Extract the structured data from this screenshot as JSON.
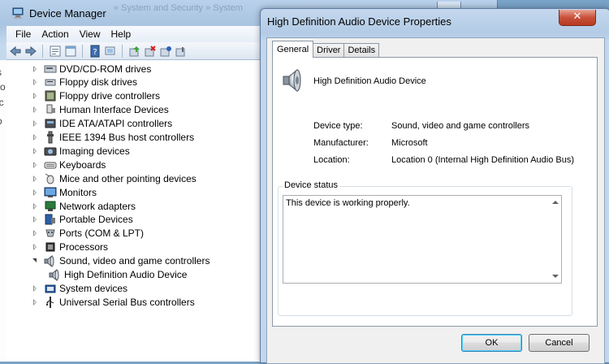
{
  "device_manager": {
    "title": "Device Manager",
    "title_ghost": "« System and Security » System",
    "menu": [
      "File",
      "Action",
      "View",
      "Help"
    ],
    "toolbar_icons": [
      "back-icon",
      "forward-icon",
      "properties-icon",
      "show-hide-icon",
      "help-icon",
      "update-driver-icon",
      "scan-icon",
      "uninstall-icon",
      "disable-icon",
      "enable-icon"
    ],
    "tree": [
      {
        "label": "DVD/CD-ROM drives",
        "icon": "dvd-drive-icon",
        "state": "closed"
      },
      {
        "label": "Floppy disk drives",
        "icon": "floppy-disk-icon",
        "state": "closed"
      },
      {
        "label": "Floppy drive controllers",
        "icon": "floppy-controller-icon",
        "state": "closed"
      },
      {
        "label": "Human Interface Devices",
        "icon": "hid-icon",
        "state": "closed"
      },
      {
        "label": "IDE ATA/ATAPI controllers",
        "icon": "ide-controller-icon",
        "state": "closed"
      },
      {
        "label": "IEEE 1394 Bus host controllers",
        "icon": "firewire-icon",
        "state": "closed"
      },
      {
        "label": "Imaging devices",
        "icon": "camera-icon",
        "state": "closed"
      },
      {
        "label": "Keyboards",
        "icon": "keyboard-icon",
        "state": "closed"
      },
      {
        "label": "Mice and other pointing devices",
        "icon": "mouse-icon",
        "state": "closed"
      },
      {
        "label": "Monitors",
        "icon": "monitor-icon",
        "state": "closed"
      },
      {
        "label": "Network adapters",
        "icon": "network-adapter-icon",
        "state": "closed"
      },
      {
        "label": "Portable Devices",
        "icon": "portable-device-icon",
        "state": "closed"
      },
      {
        "label": "Ports (COM & LPT)",
        "icon": "port-icon",
        "state": "closed"
      },
      {
        "label": "Processors",
        "icon": "processor-icon",
        "state": "closed"
      },
      {
        "label": "Sound, video and game controllers",
        "icon": "speaker-icon",
        "state": "open"
      },
      {
        "label": "High Definition Audio Device",
        "icon": "speaker-icon",
        "state": "child"
      },
      {
        "label": "System devices",
        "icon": "system-device-icon",
        "state": "closed"
      },
      {
        "label": "Universal Serial Bus controllers",
        "icon": "usb-icon",
        "state": "closed"
      }
    ],
    "sliver_text": [
      "s",
      "ro",
      "ic",
      "o"
    ]
  },
  "dialog": {
    "title": "High Definition Audio Device Properties",
    "close_glyph": "✕",
    "tabs": [
      "General",
      "Driver",
      "Details"
    ],
    "device_name": "High Definition Audio Device",
    "props": [
      {
        "label": "Device type:",
        "value": "Sound, video and game controllers"
      },
      {
        "label": "Manufacturer:",
        "value": "Microsoft"
      },
      {
        "label": "Location:",
        "value": "Location 0 (Internal High Definition Audio Bus)"
      }
    ],
    "status_legend": "Device status",
    "status_text": "This device is working properly.",
    "ok_label": "OK",
    "cancel_label": "Cancel"
  }
}
